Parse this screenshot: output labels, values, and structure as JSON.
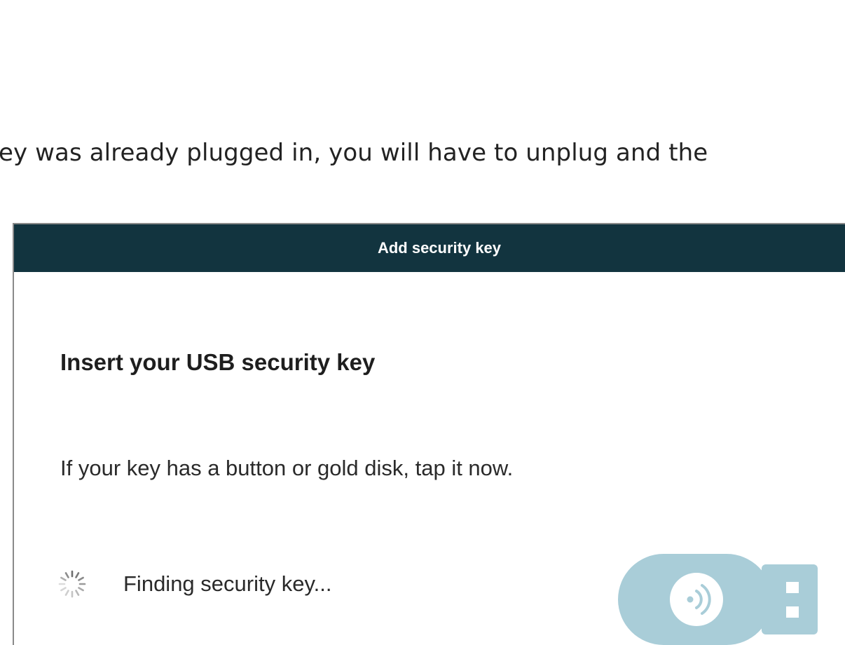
{
  "intro_text": "ey was already plugged in, you will have to unplug and the",
  "dialog": {
    "title": "Add security key",
    "heading": "Insert your USB security key",
    "instruction": "If your key has a button or gold disk, tap it now.",
    "status": "Finding security key...",
    "icons": {
      "spinner": "loading-spinner-icon",
      "usb_key": "usb-security-key-icon"
    }
  },
  "colors": {
    "titlebar": "#12343f",
    "usb_key_body": "#a9cdd8",
    "border": "#8a8a8a"
  }
}
